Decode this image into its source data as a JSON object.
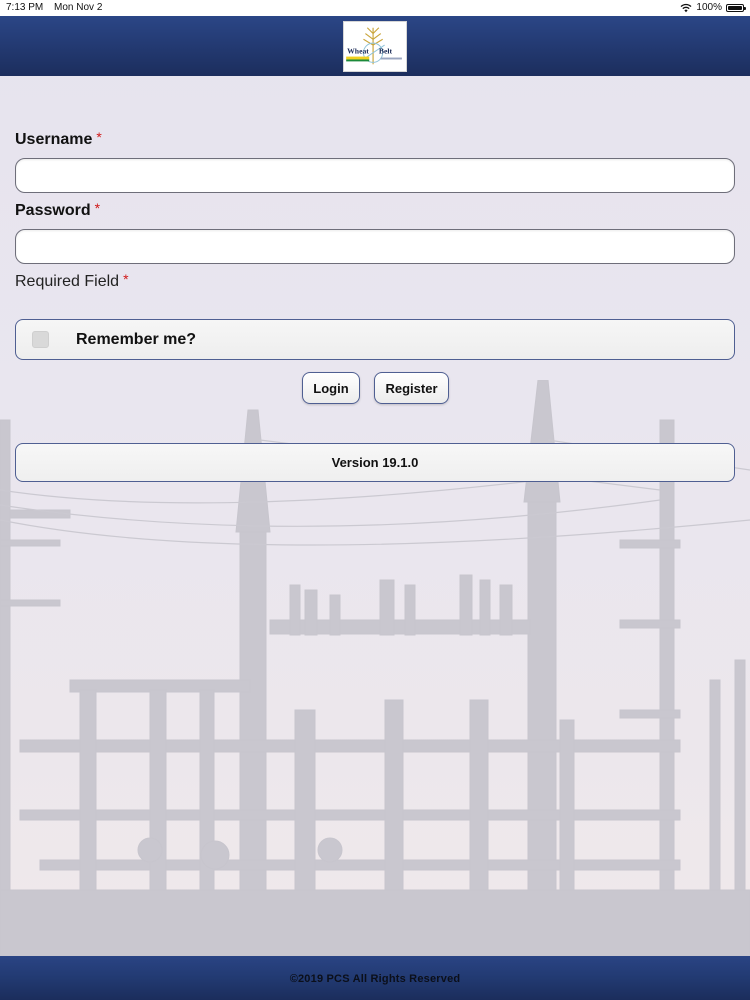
{
  "status_bar": {
    "time": "7:13 PM",
    "date": "Mon Nov 2",
    "battery": "100%"
  },
  "header": {
    "logo_line1": "Wheat",
    "logo_line2": "Belt"
  },
  "form": {
    "username_label": "Username",
    "password_label": "Password",
    "required_star": "*",
    "username_value": "",
    "password_value": "",
    "required_note": "Required Field",
    "remember_label": "Remember me?",
    "remember_checked": false,
    "login_label": "Login",
    "register_label": "Register",
    "version_text": "Version 19.1.0"
  },
  "footer": {
    "copyright": "©2019 PCS All Rights Reserved"
  },
  "colors": {
    "header_blue": "#243b74",
    "required_red": "#d01818",
    "border_blue": "#4f5f92"
  },
  "icons": {
    "wifi": "wifi-icon",
    "battery": "battery-icon",
    "logo": "wheat-belt-logo"
  }
}
